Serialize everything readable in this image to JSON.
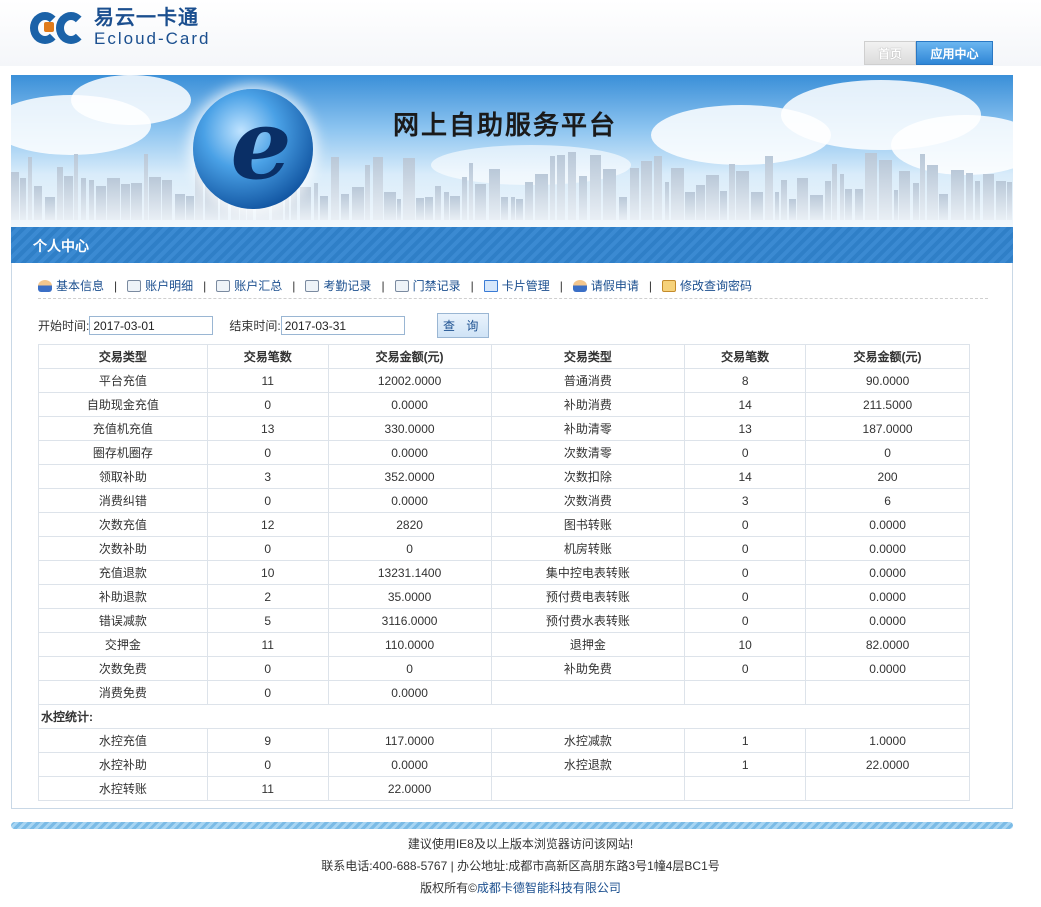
{
  "brand": {
    "name_cn": "易云一卡通",
    "name_en": "Ecloud-Card"
  },
  "nav": {
    "home": "首页",
    "app_center": "应用中心"
  },
  "banner": {
    "title": "网上自助服务平台"
  },
  "section": {
    "title": "个人中心"
  },
  "menu": [
    {
      "label": "基本信息",
      "icon": "user-icon"
    },
    {
      "label": "账户明细",
      "icon": "document-icon"
    },
    {
      "label": "账户汇总",
      "icon": "document-icon"
    },
    {
      "label": "考勤记录",
      "icon": "document-icon"
    },
    {
      "label": "门禁记录",
      "icon": "document-icon"
    },
    {
      "label": "卡片管理",
      "icon": "card-icon"
    },
    {
      "label": "请假申请",
      "icon": "user-icon"
    },
    {
      "label": "修改查询密码",
      "icon": "key-icon"
    }
  ],
  "search": {
    "start_label": "开始时间:",
    "start_value": "2017-03-01",
    "end_label": "结束时间:",
    "end_value": "2017-03-31",
    "button": "查 询"
  },
  "table": {
    "headers": [
      "交易类型",
      "交易笔数",
      "交易金额(元)",
      "交易类型",
      "交易笔数",
      "交易金额(元)"
    ],
    "rows": [
      [
        "平台充值",
        "11",
        "12002.0000",
        "普通消费",
        "8",
        "90.0000"
      ],
      [
        "自助现金充值",
        "0",
        "0.0000",
        "补助消费",
        "14",
        "211.5000"
      ],
      [
        "充值机充值",
        "13",
        "330.0000",
        "补助清零",
        "13",
        "187.0000"
      ],
      [
        "圈存机圈存",
        "0",
        "0.0000",
        "次数清零",
        "0",
        "0"
      ],
      [
        "领取补助",
        "3",
        "352.0000",
        "次数扣除",
        "14",
        "200"
      ],
      [
        "消费纠错",
        "0",
        "0.0000",
        "次数消费",
        "3",
        "6"
      ],
      [
        "次数充值",
        "12",
        "2820",
        "图书转账",
        "0",
        "0.0000"
      ],
      [
        "次数补助",
        "0",
        "0",
        "机房转账",
        "0",
        "0.0000"
      ],
      [
        "充值退款",
        "10",
        "13231.1400",
        "集中控电表转账",
        "0",
        "0.0000"
      ],
      [
        "补助退款",
        "2",
        "35.0000",
        "预付费电表转账",
        "0",
        "0.0000"
      ],
      [
        "错误减款",
        "5",
        "3116.0000",
        "预付费水表转账",
        "0",
        "0.0000"
      ],
      [
        "交押金",
        "11",
        "110.0000",
        "退押金",
        "10",
        "82.0000"
      ],
      [
        "次数免费",
        "0",
        "0",
        "补助免费",
        "0",
        "0.0000"
      ],
      [
        "消费免费",
        "0",
        "0.0000",
        "",
        "",
        ""
      ]
    ],
    "water_group_label": "水控统计:",
    "water_rows": [
      [
        "水控充值",
        "9",
        "117.0000",
        "水控减款",
        "1",
        "1.0000"
      ],
      [
        "水控补助",
        "0",
        "0.0000",
        "水控退款",
        "1",
        "22.0000"
      ],
      [
        "水控转账",
        "11",
        "22.0000",
        "",
        "",
        ""
      ]
    ]
  },
  "footer": {
    "browser_tip": "建议使用IE8及以上版本浏览器访问该网站!",
    "contact": "联系电话:400-688-5767 | 办公地址:成都市高新区高朋东路3号1幢4层BC1号",
    "copyright_prefix": "版权所有©",
    "company": "成都卡德智能科技有限公司"
  }
}
